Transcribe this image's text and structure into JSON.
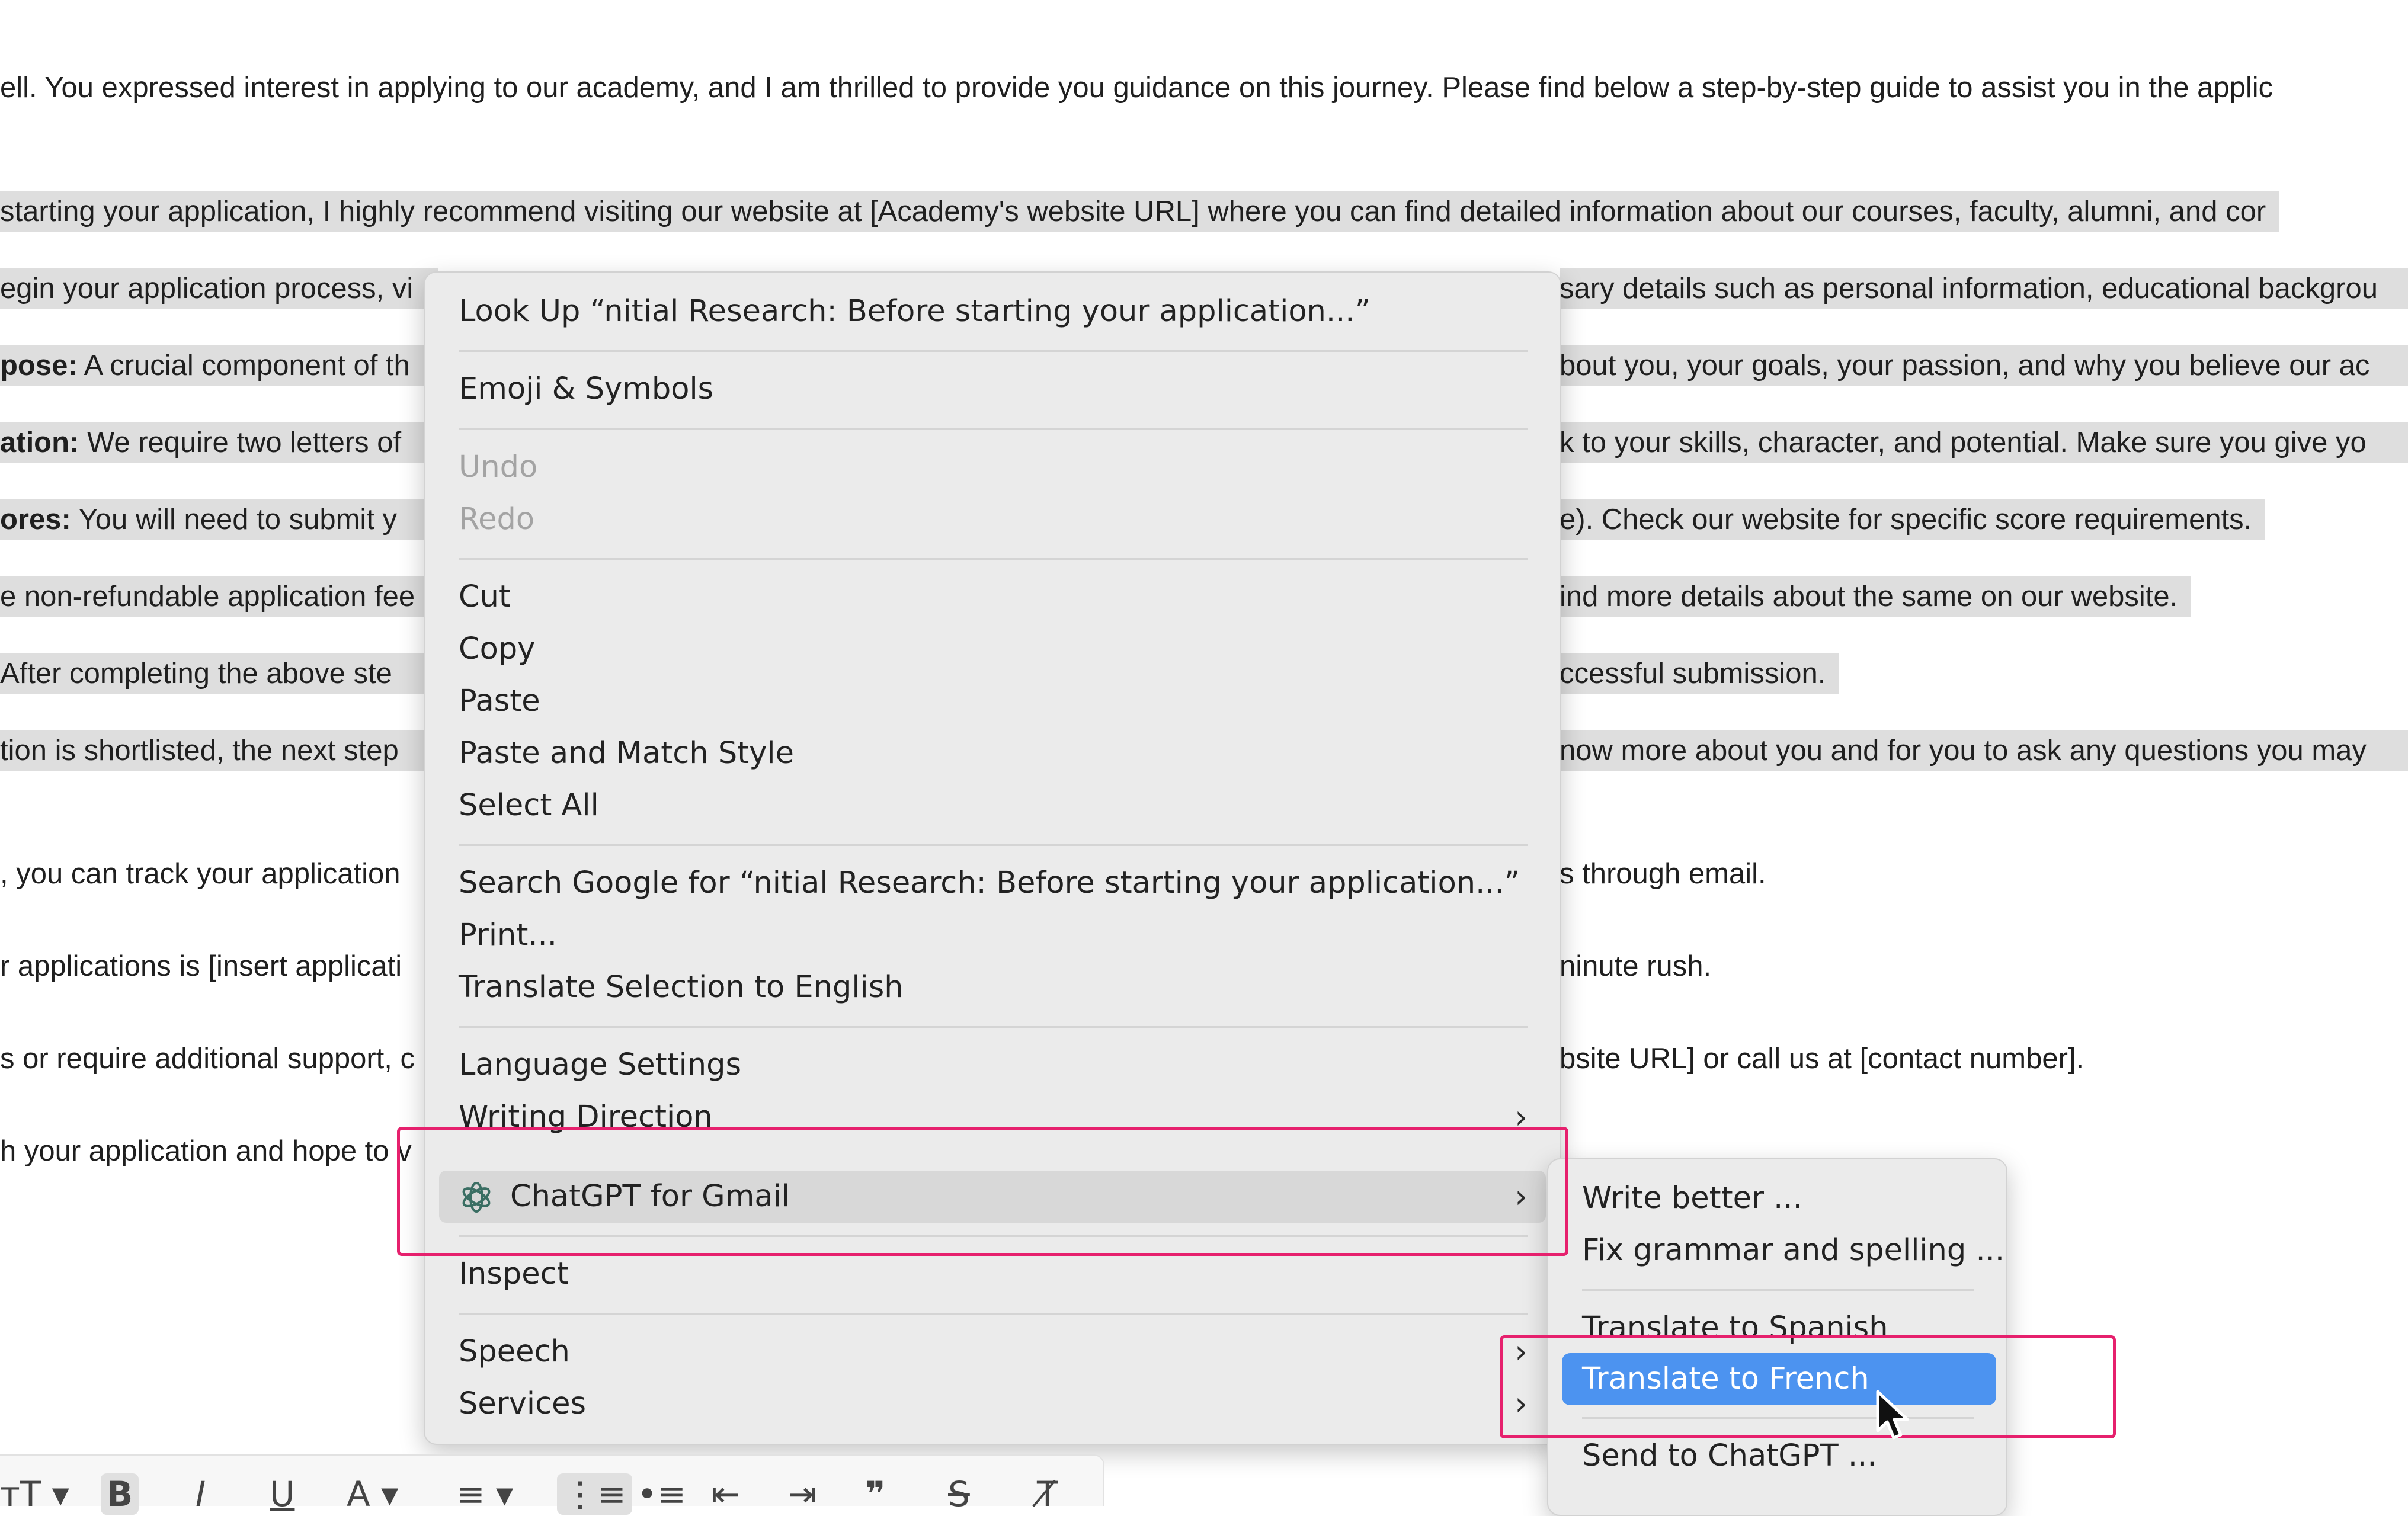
{
  "email": {
    "lines": [
      {
        "bold": "",
        "text": "ell. You expressed interest in applying to our academy, and I am thrilled to provide you guidance on this journey. Please find below a step-by-step guide to assist you in the applic",
        "tail": ""
      },
      {
        "bold": "",
        "text": "starting your application, I highly recommend visiting our website at [Academy's website URL] where you can find detailed information about our courses, faculty, alumni, and cor",
        "tail": ""
      },
      {
        "bold": "",
        "text": "egin your application process, vi",
        "tail": "sary details such as personal information, educational backgrou"
      },
      {
        "bold": "pose:",
        "text": " A crucial component of th",
        "tail": "bout you, your goals, your passion, and why you believe our ac"
      },
      {
        "bold": "ation:",
        "text": " We require two letters of",
        "tail": "k to your skills, character, and potential. Make sure you give yo"
      },
      {
        "bold": "ores:",
        "text": " You will need to submit y",
        "tail": "e). Check our website for specific score requirements."
      },
      {
        "bold": "",
        "text": "e non-refundable application fee",
        "tail": "ind more details about the same on our website."
      },
      {
        "bold": "",
        "text": " After completing the above ste",
        "tail": "ccessful submission."
      },
      {
        "bold": "",
        "text": "tion is shortlisted, the next step",
        "tail": "now more about you and for you to ask any questions you may"
      },
      {
        "bold": "",
        "text": ", you can track your application",
        "tail": "s through email."
      },
      {
        "bold": "",
        "text": "r applications is [insert applicati",
        "tail": "ninute rush."
      },
      {
        "bold": "",
        "text": "s or require additional support, c",
        "tail": "bsite URL] or call us at [contact number]."
      },
      {
        "bold": "",
        "text": "h your application and hope to v",
        "tail": ""
      }
    ]
  },
  "context_menu": {
    "look_up": "Look Up “nitial Research: Before starting your application...”",
    "emoji": "Emoji & Symbols",
    "undo": "Undo",
    "redo": "Redo",
    "cut": "Cut",
    "copy": "Copy",
    "paste": "Paste",
    "paste_match": "Paste and Match Style",
    "select_all": "Select All",
    "search_google": "Search Google for “nitial Research: Before starting your application...”",
    "print": "Print...",
    "translate_selection": "Translate Selection to English",
    "language_settings": "Language Settings",
    "writing_direction": "Writing Direction",
    "chatgpt": "ChatGPT for Gmail",
    "inspect": "Inspect",
    "speech": "Speech",
    "services": "Services"
  },
  "submenu": {
    "write_better": "Write better ...",
    "fix_grammar": "Fix grammar and spelling ...",
    "translate_spanish": "Translate to Spanish",
    "translate_french": "Translate to French",
    "send_chatgpt": "Send to ChatGPT ..."
  },
  "toolbar": {
    "text_size": "тT",
    "bold": "B",
    "italic": "I",
    "underline": "U",
    "text_color": "A"
  },
  "colors": {
    "highlight_annotation": "#e6206d",
    "selection_blue": "#4c93f0",
    "text_selection_gray": "#dedede"
  }
}
